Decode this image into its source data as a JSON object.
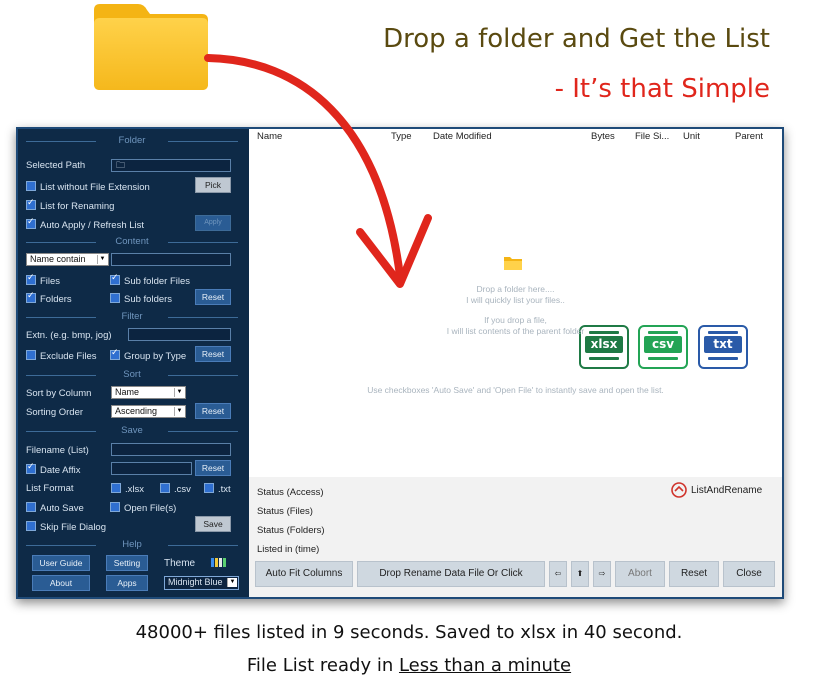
{
  "banner": {
    "headline": "Drop a folder and Get the List",
    "subheadline": "- It’s that Simple",
    "folder_icon": "folder-icon",
    "arrow_color": "#e0261c"
  },
  "sidebar": {
    "sections": {
      "folder": "Folder",
      "content": "Content",
      "filter": "Filter",
      "sort": "Sort",
      "save": "Save",
      "help": "Help"
    },
    "folder": {
      "selected_path_label": "Selected Path",
      "selected_path_value": "",
      "list_without_ext": "List without File Extension",
      "pick": "Pick",
      "list_for_renaming": "List for Renaming",
      "auto_apply": "Auto Apply / Refresh List",
      "apply": "Apply"
    },
    "content": {
      "name_filter_select": "Name contain",
      "name_filter_value": "",
      "files": "Files",
      "sub_folder_files": "Sub folder Files",
      "folders": "Folders",
      "sub_folders": "Sub folders",
      "reset": "Reset"
    },
    "filter": {
      "extn_label": "Extn. (e.g. bmp, jog)",
      "extn_value": "",
      "exclude_files": "Exclude Files",
      "group_by_type": "Group by Type",
      "reset": "Reset"
    },
    "sort": {
      "sort_by_label": "Sort by Column",
      "sort_by_value": "Name",
      "order_label": "Sorting Order",
      "order_value": "Ascending",
      "reset": "Reset"
    },
    "save": {
      "filename_label": "Filename (List)",
      "filename_value": "",
      "date_affix": "Date Affix",
      "date_affix_value": "",
      "reset": "Reset",
      "list_format_label": "List Format",
      "xlsx": ".xlsx",
      "csv": ".csv",
      "txt": ".txt",
      "auto_save": "Auto Save",
      "open_files": "Open File(s)",
      "skip_dialog": "Skip File Dialog",
      "save": "Save"
    },
    "help": {
      "user_guide": "User Guide",
      "setting": "Setting",
      "theme_label": "Theme",
      "about": "About",
      "apps": "Apps",
      "theme_value": "Midnight Blue"
    }
  },
  "table": {
    "columns": [
      "Name",
      "Type",
      "Date Modified",
      "Bytes",
      "File Si...",
      "Unit",
      "Parent"
    ]
  },
  "drop_hints": {
    "line1": "Drop a folder here....",
    "line2": "I will quickly list your files..",
    "line3": "If you drop a file,",
    "line4": "I will list contents of the parent folder",
    "line5": "Use checkboxes 'Auto Save' and 'Open File' to instantly save and open the list."
  },
  "format_icons": [
    {
      "label": "xlsx",
      "color": "#1f7a45"
    },
    {
      "label": "csv",
      "color": "#23a455"
    },
    {
      "label": "txt",
      "color": "#2a5aa8"
    }
  ],
  "status": {
    "access": "Status (Access)",
    "files": "Status (Files)",
    "folders": "Status (Folders)",
    "time": "Listed in (time)",
    "brand": "ListAndRename"
  },
  "bottom_buttons": {
    "auto_fit": "Auto Fit Columns",
    "drop_rename": "Drop Rename Data File Or Click",
    "prev": "⇦",
    "up": "⬆",
    "next": "⇨",
    "abort": "Abort",
    "reset": "Reset",
    "close": "Close"
  },
  "footer": {
    "line1": "48000+ files listed in 9 seconds. Saved to xlsx in 40 second.",
    "line2_prefix": "File List ready in ",
    "line2_link": "Less than a minute"
  }
}
